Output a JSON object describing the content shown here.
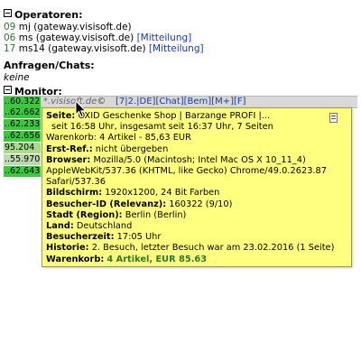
{
  "operators": {
    "title": "Operatoren:",
    "items": [
      {
        "count": "09",
        "name": "mj (gateway.visisoft.de)",
        "link": ""
      },
      {
        "count": "06",
        "name": "ms (gateway.visisoft.de)",
        "link": "[Mitteilung]"
      },
      {
        "count": "17",
        "name": "ms14 (gateway.visisoft.de)",
        "link": "[Mitteilung]"
      }
    ]
  },
  "requests": {
    "title": "Anfragen/Chats:",
    "empty": "keine"
  },
  "monitor": {
    "title": "Monitor:",
    "selected_row": {
      "ip": "..60.322",
      "host": "*.visisoft.de",
      "copy": "©",
      "links": "[7|2.|DE][Chat][Bem][M+][F]"
    },
    "rows": [
      {
        "ip": "..62.662",
        "color": "#3cc83c"
      },
      {
        "ip": "..62.233",
        "color": "#3cc83c"
      },
      {
        "ip": "..62.656",
        "color": "#3cc83c"
      },
      {
        "ip": "95.204",
        "color": "#a6dc8a"
      },
      {
        "ip": "..55.970",
        "color": "#bcd8b0"
      },
      {
        "ip": "..62.643",
        "color": "#3cc83c"
      }
    ]
  },
  "tooltip": {
    "page_label": "Seite:",
    "page_value": "OXID Geschenke Shop | Barzange PROFI |...",
    "time_line": "seit 16:58 Uhr, insgesamt seit 16:37 Uhr, 7 Seiten",
    "basket_line": "Warenkorb: 4 Artikel - 85,63 EUR",
    "ref_label": "Erst-Ref.:",
    "ref_value": "nicht übergeben",
    "browser_label": "Browser:",
    "browser_value": "Mozilla/5.0 (Macintosh; Intel Mac OS X 10_11_4)",
    "browser_line2": "AppleWebKit/537.36 (KHTML, like Gecko) Chrome/49.0.2623.87",
    "browser_line3": "Safari/537.36",
    "screen_label": "Bildschirm:",
    "screen_value": "1920x1200, 24 Bit Farben",
    "visitor_label": "Besucher-ID (Relevanz):",
    "visitor_value": "160322 (9/10)",
    "city_label": "Stadt (Region):",
    "city_value": "Berlin (Berlin)",
    "country_label": "Land:",
    "country_value": "Deutschland",
    "time_label": "Besucherzeit:",
    "time_value": "17:05 Uhr",
    "history_label": "Historie:",
    "history_value": "2. Besuch, letzter Besuch war am 23.02.2016 (1 Seite)",
    "cart_label": "Warenkorb:",
    "cart_value": "4 Artikel, EUR 85.63"
  }
}
